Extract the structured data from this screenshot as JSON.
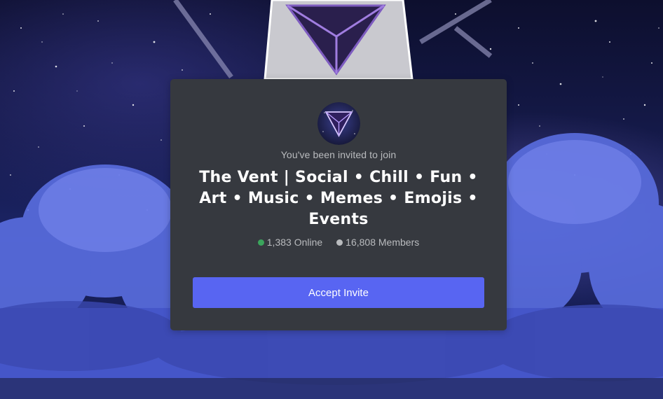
{
  "invite": {
    "subtitle": "You've been invited to join",
    "server_name": "The Vent | Social • Chill • Fun • Art • Music • Memes • Emojis • Events",
    "online_count": "1,383 Online",
    "member_count": "16,808 Members",
    "accept_label": "Accept Invite"
  },
  "colors": {
    "card_bg": "#36393f",
    "accept_button": "#5865f2",
    "online_dot": "#3ba55c",
    "members_dot": "#b9bbbe"
  },
  "icons": {
    "server_avatar": "purple-triangle-logo-icon",
    "online_status": "green-dot-icon",
    "members_status": "gray-dot-icon"
  }
}
